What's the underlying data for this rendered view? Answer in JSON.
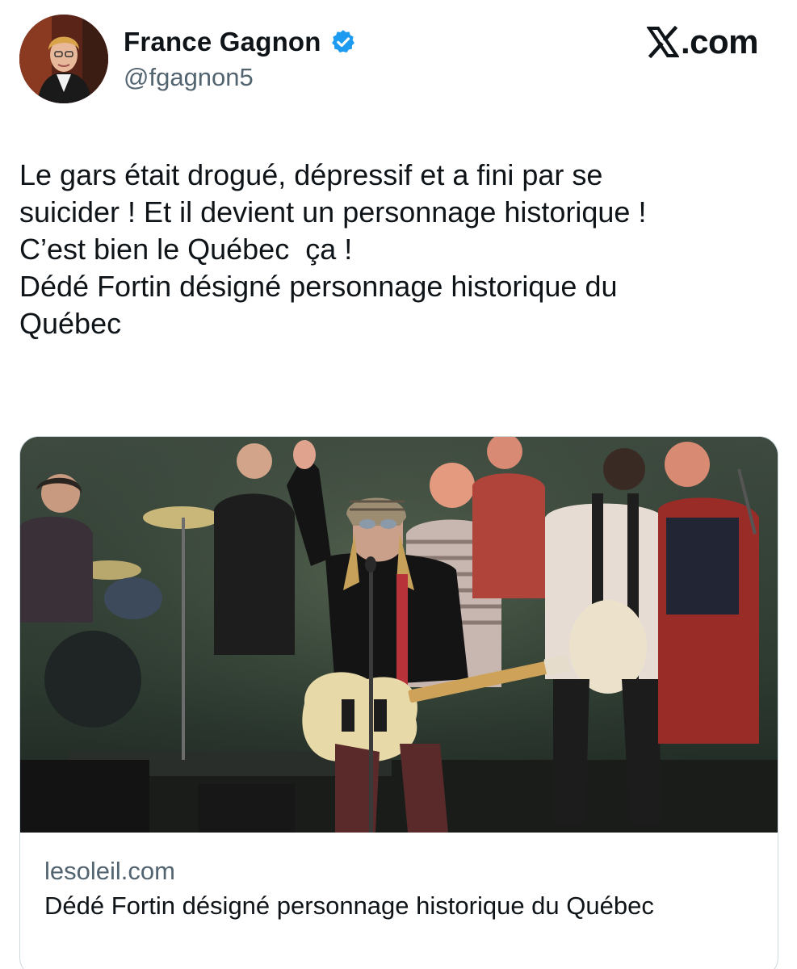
{
  "author": {
    "display_name": "France Gagnon",
    "handle": "@fgagnon5",
    "verified": true,
    "avatar": "profile-photo"
  },
  "brand": {
    "text": ".com",
    "logo": "x-logo-icon"
  },
  "tweet": {
    "lines": [
      "Le gars était drogué, dépressif et a fini par se",
      "suicider ! Et il devient un personnage historique !",
      "C’est bien le Québec  ça !",
      "Dédé Fortin désigné personnage historique du",
      "Québec"
    ]
  },
  "link_card": {
    "domain": "lesoleil.com",
    "title": "Dédé Fortin désigné personnage historique du Québec",
    "image": "concert-photo"
  },
  "colors": {
    "text": "#0f1419",
    "secondary": "#536471",
    "verified": "#1d9bf0",
    "border": "#cfd9de"
  }
}
